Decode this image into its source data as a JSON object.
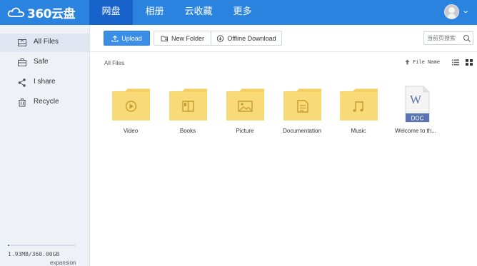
{
  "app": {
    "logo_text": "360云盘",
    "nav": [
      {
        "label": "网盘",
        "active": true
      },
      {
        "label": "相册",
        "active": false
      },
      {
        "label": "云收藏",
        "active": false
      },
      {
        "label": "更多",
        "active": false
      }
    ],
    "accent_color": "#2b83e0",
    "active_nav_color": "#1863c9",
    "folder_color": "#f7d774",
    "avatar_caret": "⌄"
  },
  "sidebar": {
    "items": [
      {
        "label": "All Files",
        "icon": "hard-drive-icon",
        "active": true
      },
      {
        "label": "Safe",
        "icon": "safe-box-icon",
        "active": false
      },
      {
        "label": "I share",
        "icon": "share-icon",
        "active": false
      },
      {
        "label": "Recycle",
        "icon": "trash-icon",
        "active": false
      }
    ],
    "quota": {
      "used_fraction": 0.005,
      "text": "1.93MB/360.00GB",
      "expansion_label": "expansion"
    }
  },
  "toolbar": {
    "upload_label": "Upload",
    "new_folder_label": "New Folder",
    "offline_download_label": "Offline Download",
    "search_placeholder": "当前页搜索"
  },
  "content": {
    "breadcrumb": "All Files",
    "sort_label": "File Name",
    "files": [
      {
        "name": "Video",
        "type": "folder",
        "glyph": "play-icon"
      },
      {
        "name": "Books",
        "type": "folder",
        "glyph": "book-icon"
      },
      {
        "name": "Picture",
        "type": "folder",
        "glyph": "image-icon"
      },
      {
        "name": "Documentation",
        "type": "folder",
        "glyph": "document-icon"
      },
      {
        "name": "Music",
        "type": "folder",
        "glyph": "music-note-icon"
      },
      {
        "name": "Welcome to th...",
        "type": "doc",
        "glyph": "word-doc-icon",
        "badge": "DOC",
        "letter": "W"
      }
    ]
  }
}
